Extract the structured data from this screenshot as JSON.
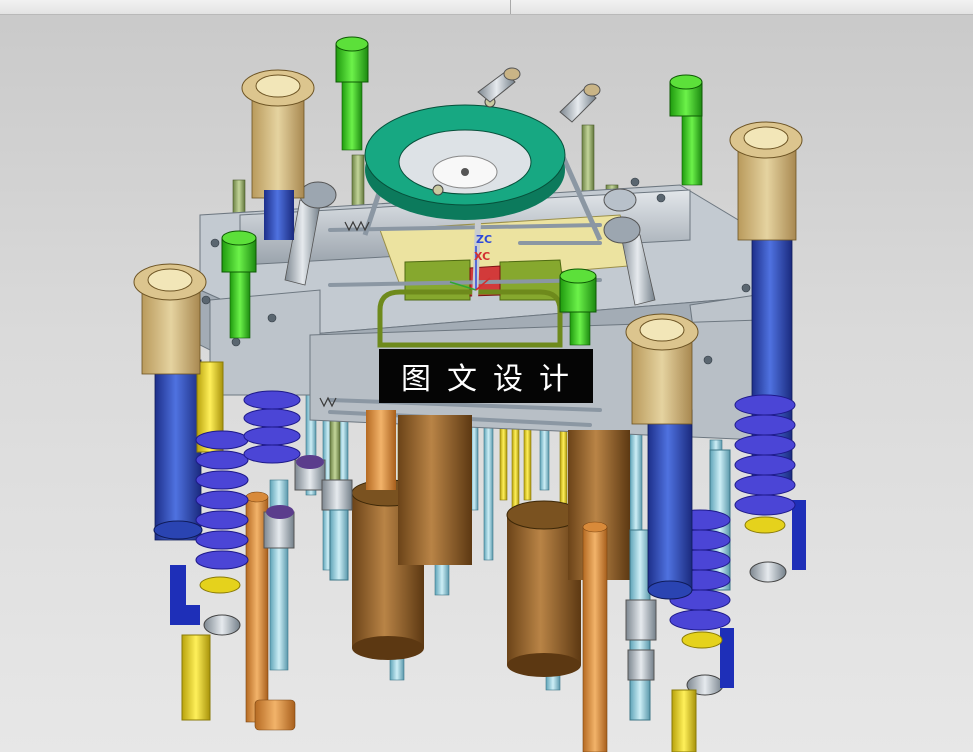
{
  "watermark": {
    "text": "图文设计"
  },
  "triad": {
    "zc_label": "ZC",
    "xc_label": "XC"
  },
  "colors": {
    "background": "#d8d8d8",
    "plate": "#b4bcc4",
    "green_screw": "#39d11f",
    "teal_ring": "#10a57f",
    "tan_bushing": "#d6c08a",
    "blue_column": "#2e4fc2",
    "spring_purple": "#4b45d6",
    "yellow_pin": "#e5d21c",
    "brown_cylinder": "#9b6a32",
    "orange_rod": "#e39a45",
    "light_blue_pin": "#9ad0e0",
    "olive_bolt": "#9aaf6d",
    "zc_color": "#2f4ad8",
    "xc_color": "#d23030"
  }
}
